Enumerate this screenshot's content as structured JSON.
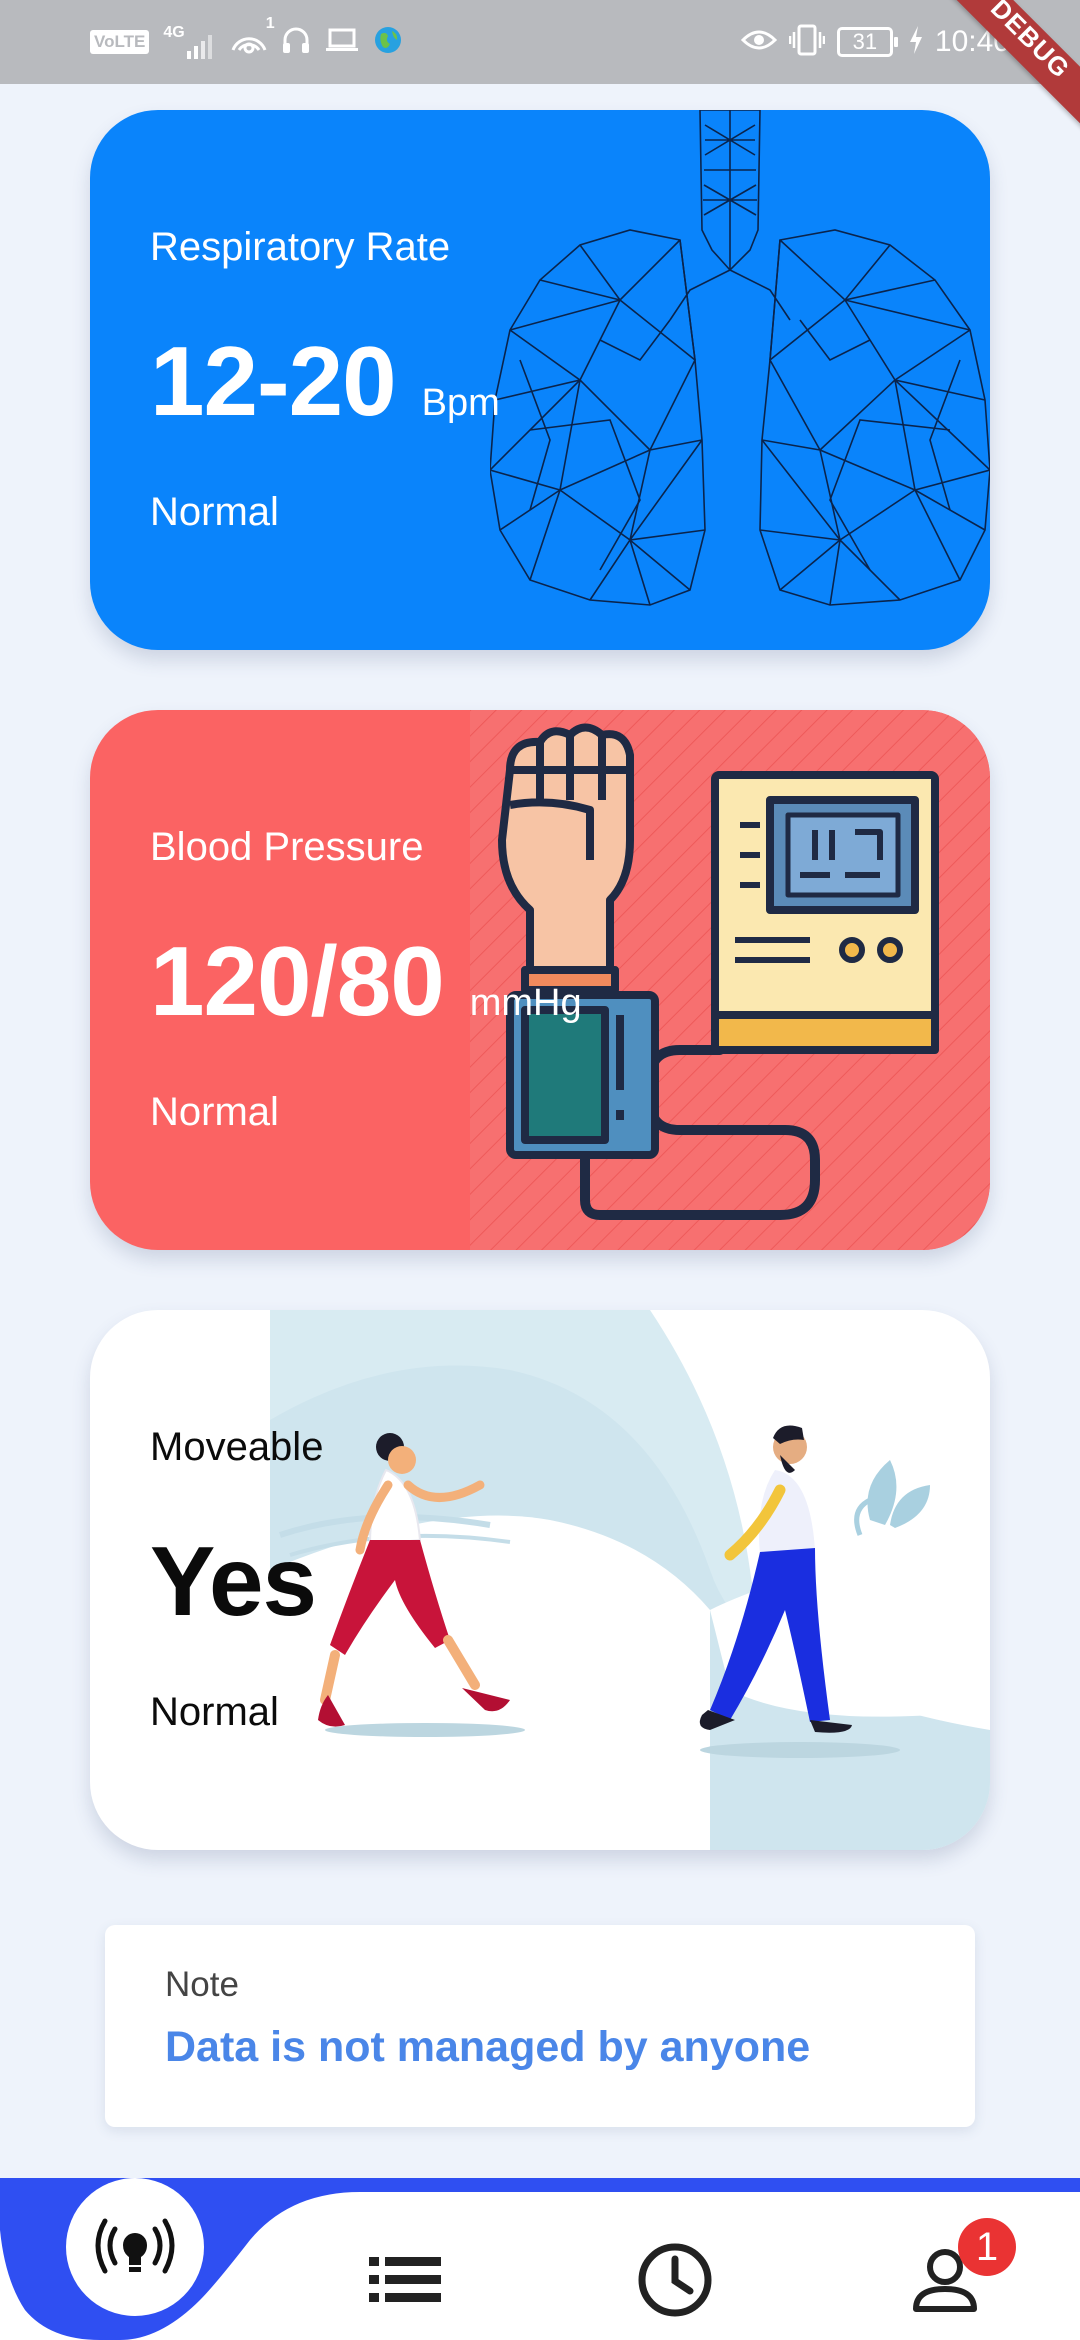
{
  "status_bar": {
    "volte": "VoLTE",
    "network": "4G",
    "hotspot_count": "1",
    "battery": "31",
    "time": "10:40",
    "debug": "DEBUG",
    "icons": [
      "signal-icon",
      "hotspot-icon",
      "headphones-icon",
      "laptop-icon",
      "globe-icon",
      "eye-icon",
      "vibrate-icon",
      "battery-icon",
      "charging-icon"
    ]
  },
  "cards": {
    "respiratory": {
      "label": "Respiratory Rate",
      "value": "12-20",
      "unit": "Bpm",
      "status": "Normal",
      "color": "#0a84fb",
      "icon": "lungs-icon"
    },
    "blood_pressure": {
      "label": "Blood Pressure",
      "value": "120/80",
      "unit": "mmHg",
      "status": "Normal",
      "color": "#fb6363",
      "icon": "blood-pressure-monitor-icon"
    },
    "moveable": {
      "label": "Moveable",
      "value": "Yes",
      "status": "Normal",
      "color": "#ffffff",
      "icon": "walking-people-illustration"
    }
  },
  "note": {
    "label": "Note",
    "text": "Data is not managed by anyone",
    "color": "#4a86e8"
  },
  "bottom_nav": {
    "accent": "#2f4ff2",
    "items": [
      {
        "icon": "broadcast-icon",
        "active": true
      },
      {
        "icon": "list-icon",
        "active": false
      },
      {
        "icon": "clock-icon",
        "active": false
      },
      {
        "icon": "profile-icon",
        "active": false,
        "badge": "1"
      }
    ]
  }
}
